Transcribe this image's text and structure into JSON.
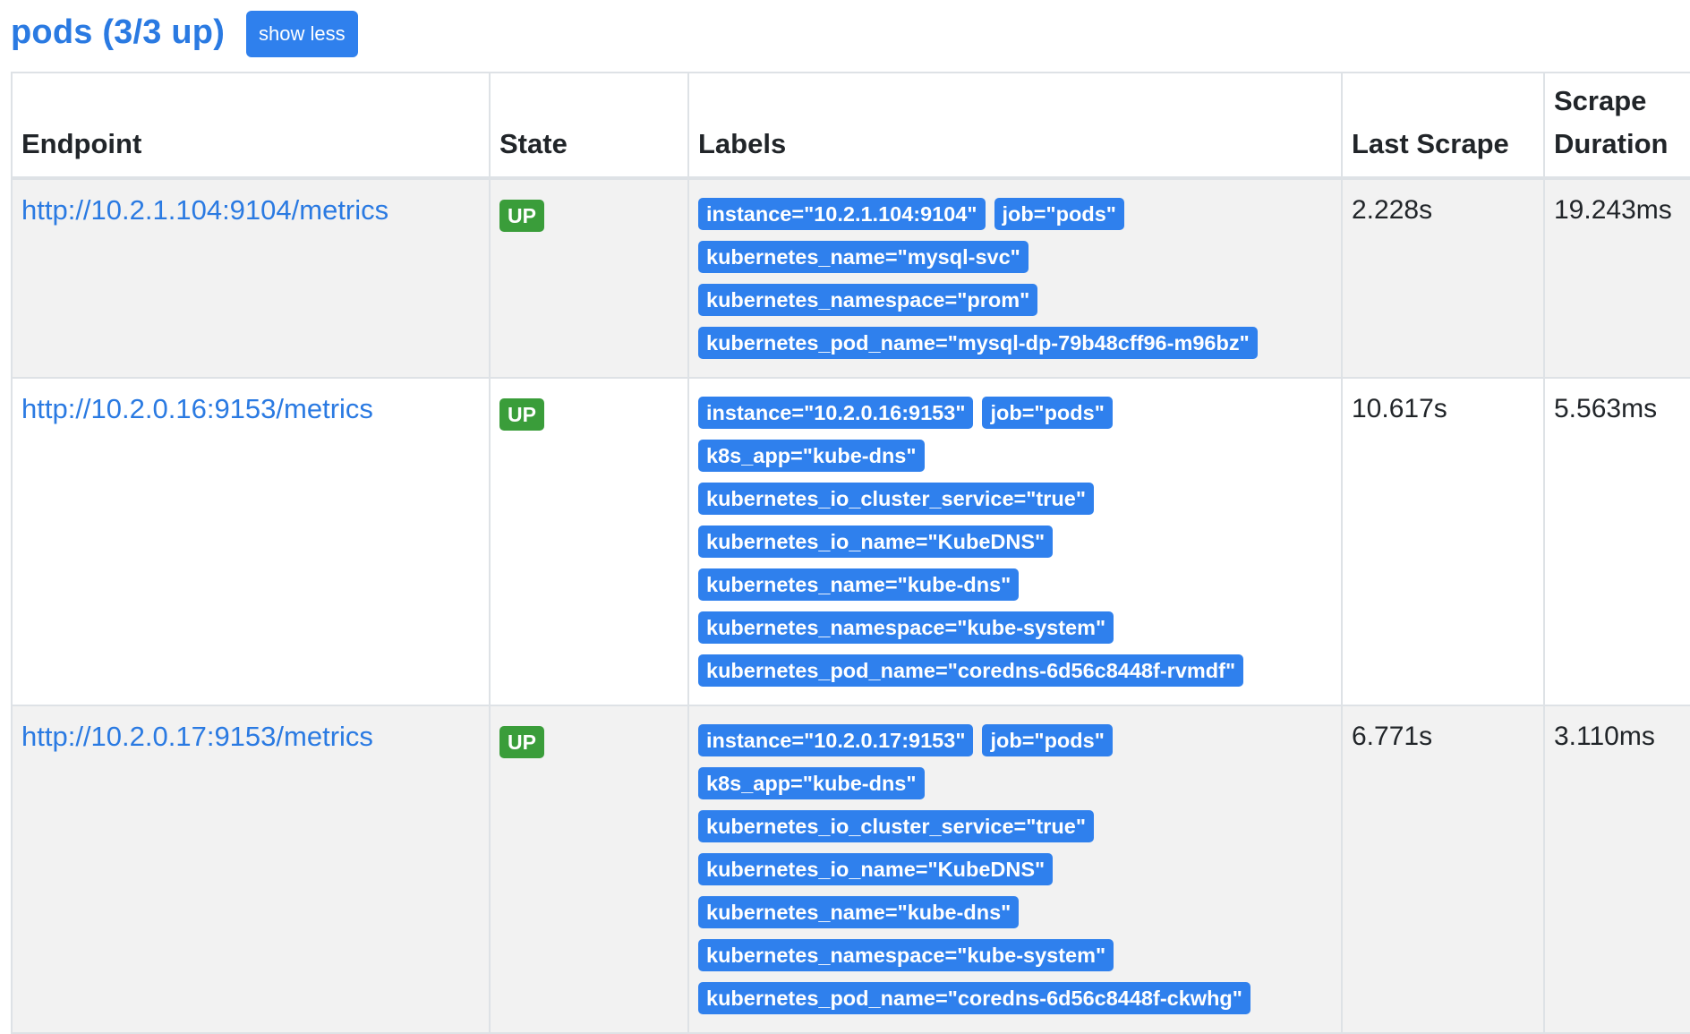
{
  "job": {
    "title": "pods (3/3 up)",
    "toggle_label": "show less"
  },
  "table": {
    "headers": {
      "endpoint": "Endpoint",
      "state": "State",
      "labels": "Labels",
      "last_scrape": "Last Scrape",
      "scrape_duration_line1": "Scrape",
      "scrape_duration_line2": "Duration"
    },
    "rows": [
      {
        "endpoint": "http://10.2.1.104:9104/metrics",
        "state": "UP",
        "labels": [
          "instance=\"10.2.1.104:9104\"",
          "job=\"pods\"",
          "kubernetes_name=\"mysql-svc\"",
          "kubernetes_namespace=\"prom\"",
          "kubernetes_pod_name=\"mysql-dp-79b48cff96-m96bz\""
        ],
        "last_scrape": "2.228s",
        "scrape_duration": "19.243ms"
      },
      {
        "endpoint": "http://10.2.0.16:9153/metrics",
        "state": "UP",
        "labels": [
          "instance=\"10.2.0.16:9153\"",
          "job=\"pods\"",
          "k8s_app=\"kube-dns\"",
          "kubernetes_io_cluster_service=\"true\"",
          "kubernetes_io_name=\"KubeDNS\"",
          "kubernetes_name=\"kube-dns\"",
          "kubernetes_namespace=\"kube-system\"",
          "kubernetes_pod_name=\"coredns-6d56c8448f-rvmdf\""
        ],
        "last_scrape": "10.617s",
        "scrape_duration": "5.563ms"
      },
      {
        "endpoint": "http://10.2.0.17:9153/metrics",
        "state": "UP",
        "labels": [
          "instance=\"10.2.0.17:9153\"",
          "job=\"pods\"",
          "k8s_app=\"kube-dns\"",
          "kubernetes_io_cluster_service=\"true\"",
          "kubernetes_io_name=\"KubeDNS\"",
          "kubernetes_name=\"kube-dns\"",
          "kubernetes_namespace=\"kube-system\"",
          "kubernetes_pod_name=\"coredns-6d56c8448f-ckwhg\""
        ],
        "last_scrape": "6.771s",
        "scrape_duration": "3.110ms"
      }
    ]
  },
  "colors": {
    "link": "#2a7ae2",
    "badge_blue": "#2f80ed",
    "badge_green": "#3a9d3a",
    "stripe": "#f2f2f2",
    "border": "#dee2e6"
  }
}
